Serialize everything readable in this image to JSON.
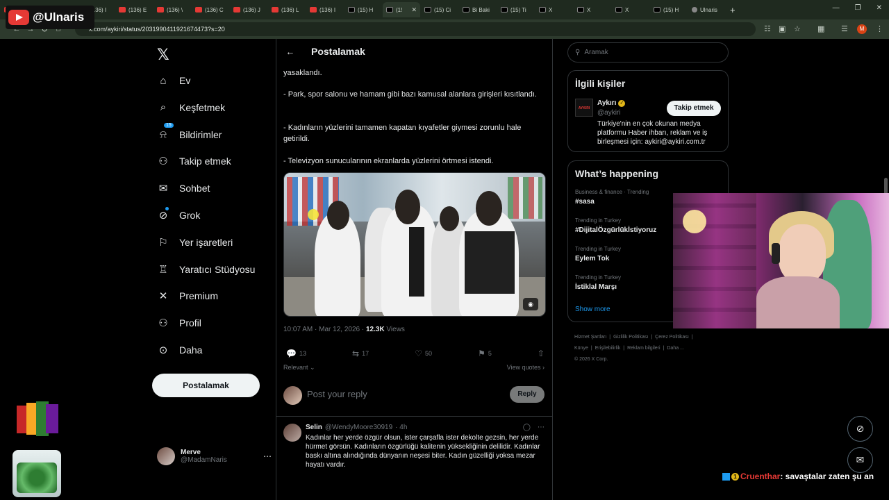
{
  "browser": {
    "tabs": [
      {
        "label": "(136) ",
        "icon": "youtube"
      },
      {
        "label": "(136) ",
        "icon": "youtube"
      },
      {
        "label": "(136) I",
        "icon": "youtube"
      },
      {
        "label": "(136) E",
        "icon": "youtube"
      },
      {
        "label": "(136) \\",
        "icon": "youtube"
      },
      {
        "label": "(136) C",
        "icon": "youtube"
      },
      {
        "label": "(136) J",
        "icon": "youtube"
      },
      {
        "label": "(136) L",
        "icon": "youtube"
      },
      {
        "label": "(136) I",
        "icon": "youtube"
      },
      {
        "label": "(15) H",
        "icon": "x"
      },
      {
        "label": "(1!",
        "icon": "x",
        "active": true
      },
      {
        "label": "(15) Ci",
        "icon": "x"
      },
      {
        "label": "Bi Baki",
        "icon": "x"
      },
      {
        "label": "(15) Ti",
        "icon": "x"
      },
      {
        "label": "X",
        "icon": "x"
      },
      {
        "label": "X",
        "icon": "x"
      },
      {
        "label": "X",
        "icon": "x"
      },
      {
        "label": "(15) H",
        "icon": "x"
      },
      {
        "label": "Ulnaris",
        "icon": "globe"
      }
    ],
    "url": "x.com/aykiri/status/2031990411921674473?s=20",
    "profile_initial": "M",
    "new_tab": "+"
  },
  "watermark": {
    "channel": "@Ulnaris"
  },
  "nav": {
    "items": [
      {
        "label": "Ev",
        "icon": "home-icon"
      },
      {
        "label": "Keşfetmek",
        "icon": "search-icon"
      },
      {
        "label": "Bildirimler",
        "icon": "bell-icon",
        "badge": "15"
      },
      {
        "label": "Takip etmek",
        "icon": "person-add-icon"
      },
      {
        "label": "Sohbet",
        "icon": "mail-icon"
      },
      {
        "label": "Grok",
        "icon": "grok-icon"
      },
      {
        "label": "Yer işaretleri",
        "icon": "bookmark-icon"
      },
      {
        "label": "Yaratıcı Stüdyosu",
        "icon": "studio-icon"
      },
      {
        "label": "Premium",
        "icon": "x-icon"
      },
      {
        "label": "Profil",
        "icon": "profile-icon"
      },
      {
        "label": "Daha",
        "icon": "more-icon"
      }
    ],
    "post_button": "Postalamak",
    "account": {
      "name": "Merve",
      "handle": "@MadamNaris"
    }
  },
  "post": {
    "header_title": "Postalamak",
    "text_lines": [
      "yasaklandı.",
      "- Park, spor salonu ve hamam gibi bazı kamusal alanlara girişleri kısıtlandı.",
      "- Kadınların yüzlerini tamamen kapatan kıyafetler giymesi zorunlu hale getirildi.",
      "- Televizyon sunucularının ekranlarda yüzlerini örtmesi istendi."
    ],
    "timestamp": "10:07 AM · Mar 12, 2026 · ",
    "views_count": "12.3K",
    "views_label": " Views",
    "actions": {
      "replies": "13",
      "reposts": "17",
      "likes": "50",
      "bookmarks": "5"
    },
    "sort_label": "Relevant",
    "view_quotes": "View quotes",
    "reply_placeholder": "Post your reply",
    "reply_button": "Reply"
  },
  "reply": {
    "name": "Selin",
    "handle": "@WendyMoore30919",
    "time": "· 4h",
    "text": "Kadınlar her yerde özgür olsun, ister çarşafla ister dekolte gezsin, her yerde hürmet görsün.  Kadınların özgürlüğü kalitenin yüksekliğinin delilidir. Kadınlar baskı altına alındığında dünyanın neşesi biter. Kadın güzelliği yoksa mezar hayatı vardır."
  },
  "right": {
    "search_placeholder": "Aramak",
    "relevant_title": "İlgili kişiler",
    "person": {
      "name": "Aykırı",
      "handle": "@aykiri",
      "bio": "Türkiye'nin en çok okunan medya platformu Haber ihbarı, reklam ve iş birleşmesi için: aykiri@aykiri.com.tr",
      "follow_label": "Takip etmek",
      "logo_text": "AYKIRI"
    },
    "happening_title": "What’s happening",
    "trends": [
      {
        "category": "Business & finance · Trending",
        "name": "#sasa"
      },
      {
        "category": "Trending in Turkey",
        "name": "#DijitalÖzgürlükİstiyoruz"
      },
      {
        "category": "Trending in Turkey",
        "name": "Eylem Tok"
      },
      {
        "category": "Trending in Turkey",
        "name": "İstiklal Marşı"
      }
    ],
    "show_more": "Show more",
    "footer_links": [
      "Hizmet Şartları",
      "|",
      "Gizlilik Politikası",
      "|",
      "Çerez Politikası",
      "|",
      "Künye",
      "|",
      "Erişilebilirlik",
      "|",
      "Reklam bilgileri",
      "|",
      "Daha ...",
      "© 2026 X Corp."
    ]
  },
  "chat": {
    "badge": "1",
    "user": "Cruenthar",
    "message": ": savaştalar zaten şu an"
  },
  "colors": {
    "accent": "#1d9bf0",
    "background": "#000000",
    "text": "#e7e9ea",
    "muted": "#71767b"
  }
}
